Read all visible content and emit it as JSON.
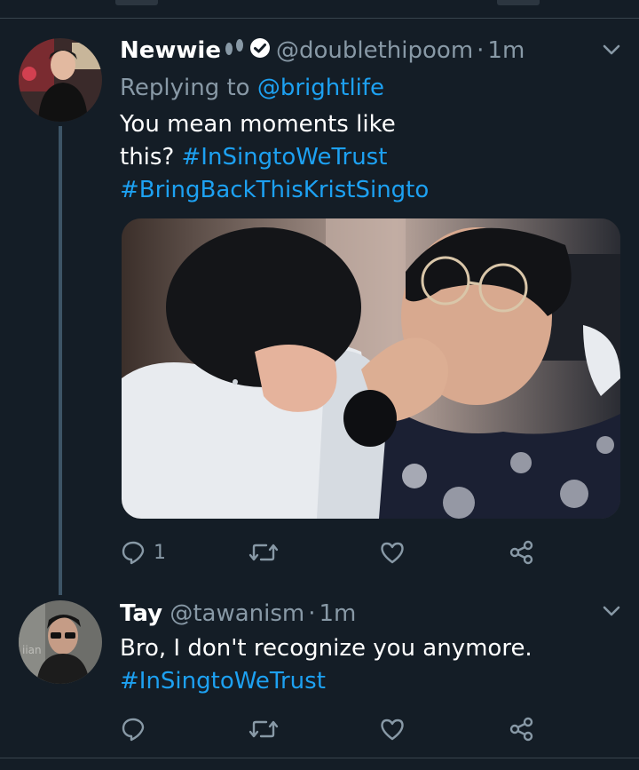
{
  "tweets": [
    {
      "name": "Newwie",
      "handle": "@doublethipoom",
      "separator": "·",
      "time": "1m",
      "replying_prefix": "Replying to",
      "replying_to": "@brightlife",
      "text_lines": [
        [
          {
            "t": "You mean moments like",
            "kind": "text"
          }
        ],
        [
          {
            "t": "this? ",
            "kind": "text"
          },
          {
            "t": "#InSingtoWeTrust",
            "kind": "hashtag"
          }
        ],
        [
          {
            "t": "#BringBackThisKristSingto",
            "kind": "hashtag"
          }
        ]
      ],
      "reply_count": "1",
      "retweet_count": "",
      "like_count": ""
    },
    {
      "name": "Tay",
      "handle": "@tawanism",
      "separator": "·",
      "time": "1m",
      "text_lines": [
        [
          {
            "t": "Bro, I don't recognize you anymore.",
            "kind": "text"
          }
        ],
        [
          {
            "t": "#InSingtoWeTrust",
            "kind": "hashtag"
          }
        ]
      ],
      "reply_count": "",
      "retweet_count": "",
      "like_count": ""
    }
  ],
  "icons": {
    "reply": "reply-icon",
    "retweet": "retweet-icon",
    "like": "heart-icon",
    "share": "share-icon",
    "menu": "chevron-down-icon",
    "verified": "verified-badge-icon",
    "emoji": "footprints-emoji"
  },
  "colors": {
    "background": "#141d26",
    "accent": "#1da1f2",
    "muted": "#8899a6",
    "divider": "#38444d",
    "thread_line": "#3d5466"
  }
}
